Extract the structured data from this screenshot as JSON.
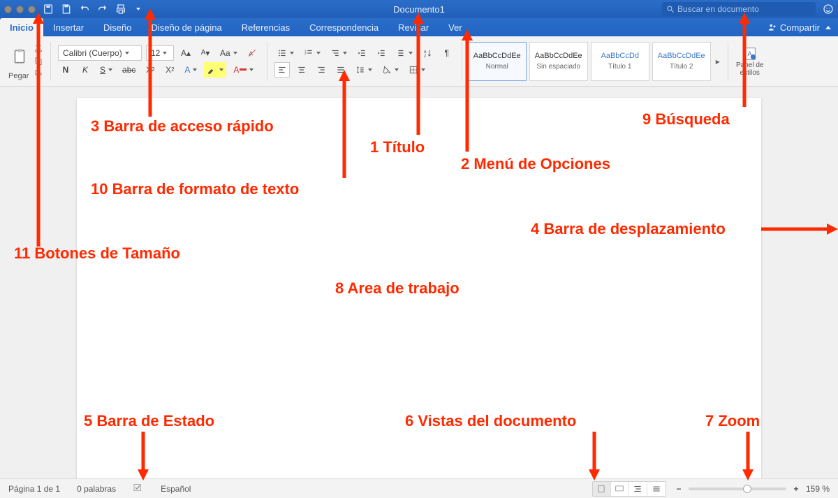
{
  "title": "Documento1",
  "search_placeholder": "Buscar en documento",
  "share_label": "Compartir",
  "tabs": [
    "Inicio",
    "Insertar",
    "Diseño",
    "Diseño de página",
    "Referencias",
    "Correspondencia",
    "Revisar",
    "Ver"
  ],
  "active_tab": 0,
  "paste_label": "Pegar",
  "font": {
    "name": "Calibri (Cuerpo)",
    "size": "12",
    "letters": {
      "N": "N",
      "K": "K",
      "S": "S"
    }
  },
  "size_btns": {
    "grow": "A",
    "shrink": "A"
  },
  "styles": [
    {
      "sample": "AaBbCcDdEe",
      "name": "Normal",
      "selected": true,
      "blue": false
    },
    {
      "sample": "AaBbCcDdEe",
      "name": "Sin espaciado",
      "selected": false,
      "blue": false
    },
    {
      "sample": "AaBbCcDd",
      "name": "Título 1",
      "selected": false,
      "blue": true
    },
    {
      "sample": "AaBbCcDdEe",
      "name": "Título 2",
      "selected": false,
      "blue": true
    }
  ],
  "panel_styles": "Panel de\nestilos",
  "status": {
    "page": "Página 1 de 1",
    "words": "0 palabras",
    "lang": "Español",
    "zoom": "159 %"
  },
  "annotations": {
    "a1": "1 Título",
    "a2": "2  Menú de Opciones",
    "a3": "3 Barra de acceso rápido",
    "a4": "4 Barra de desplazamiento",
    "a5": "5 Barra de Estado",
    "a6": "6 Vistas del documento",
    "a7": "7 Zoom",
    "a8": "8 Area de trabajo",
    "a9": "9 Búsqueda",
    "a10": "10 Barra de formato de texto",
    "a11": "11 Botones de Tamaño"
  }
}
